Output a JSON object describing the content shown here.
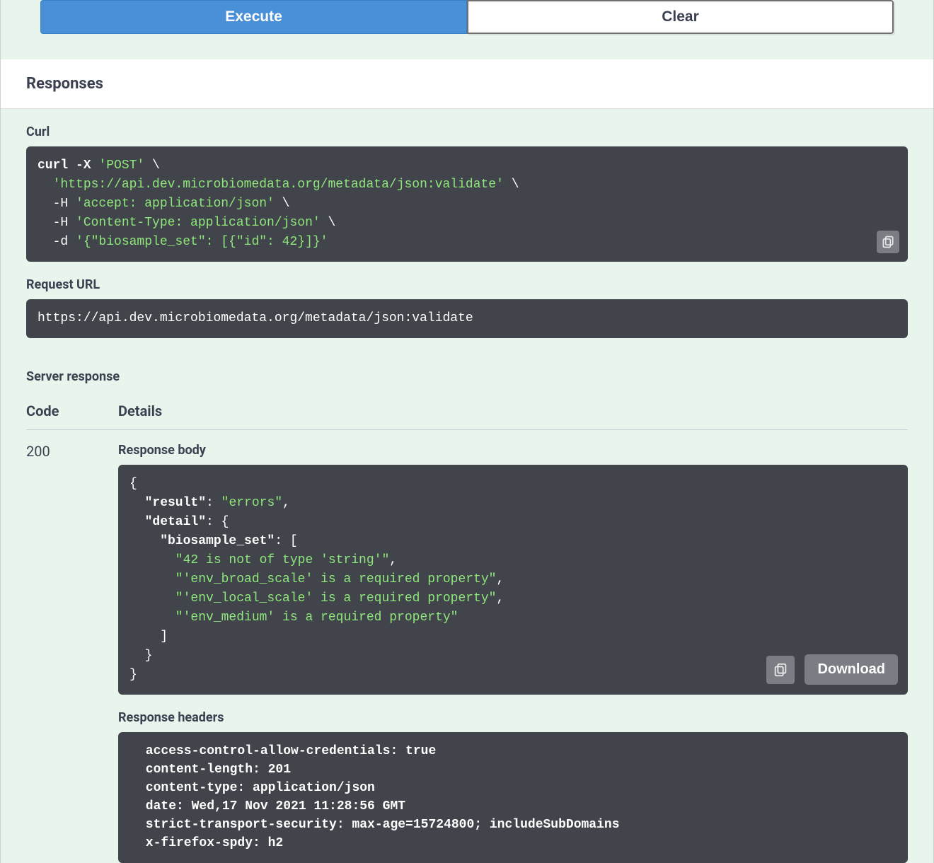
{
  "buttons": {
    "execute": "Execute",
    "clear": "Clear",
    "download": "Download"
  },
  "headings": {
    "responses": "Responses",
    "curl": "Curl",
    "request_url": "Request URL",
    "server_response": "Server response",
    "code_col": "Code",
    "details_col": "Details",
    "response_body": "Response body",
    "response_headers": "Response headers"
  },
  "curl": {
    "line1_cmd": "curl -X ",
    "line1_method": "'POST'",
    "line1_cont": " \\",
    "line2_url": "'https://api.dev.microbiomedata.org/metadata/json:validate'",
    "line2_cont": " \\",
    "line3_h": "  -H ",
    "line3_val": "'accept: application/json'",
    "line3_cont": " \\",
    "line4_h": "  -H ",
    "line4_val": "'Content-Type: application/json'",
    "line4_cont": " \\",
    "line5_d": "  -d ",
    "line5_val": "'{\"biosample_set\": [{\"id\": 42}]}'"
  },
  "request_url": "https://api.dev.microbiomedata.org/metadata/json:validate",
  "response": {
    "code": "200",
    "body": {
      "open": "{",
      "result_key": "  \"result\"",
      "result_val": "\"errors\"",
      "detail_key": "  \"detail\"",
      "detail_open": ": {",
      "bio_key": "    \"biosample_set\"",
      "bio_open": ": [",
      "err1": "      \"42 is not of type 'string'\"",
      "err2": "      \"'env_broad_scale' is a required property\"",
      "err3": "      \"'env_local_scale' is a required property\"",
      "err4": "      \"'env_medium' is a required property\"",
      "close_arr": "    ]",
      "close_detail": "  }",
      "close": "}"
    },
    "headers_lines": [
      " access-control-allow-credentials: true ",
      " content-length: 201 ",
      " content-type: application/json ",
      " date: Wed,17 Nov 2021 11:28:56 GMT ",
      " strict-transport-security: max-age=15724800; includeSubDomains ",
      " x-firefox-spdy: h2 "
    ]
  }
}
